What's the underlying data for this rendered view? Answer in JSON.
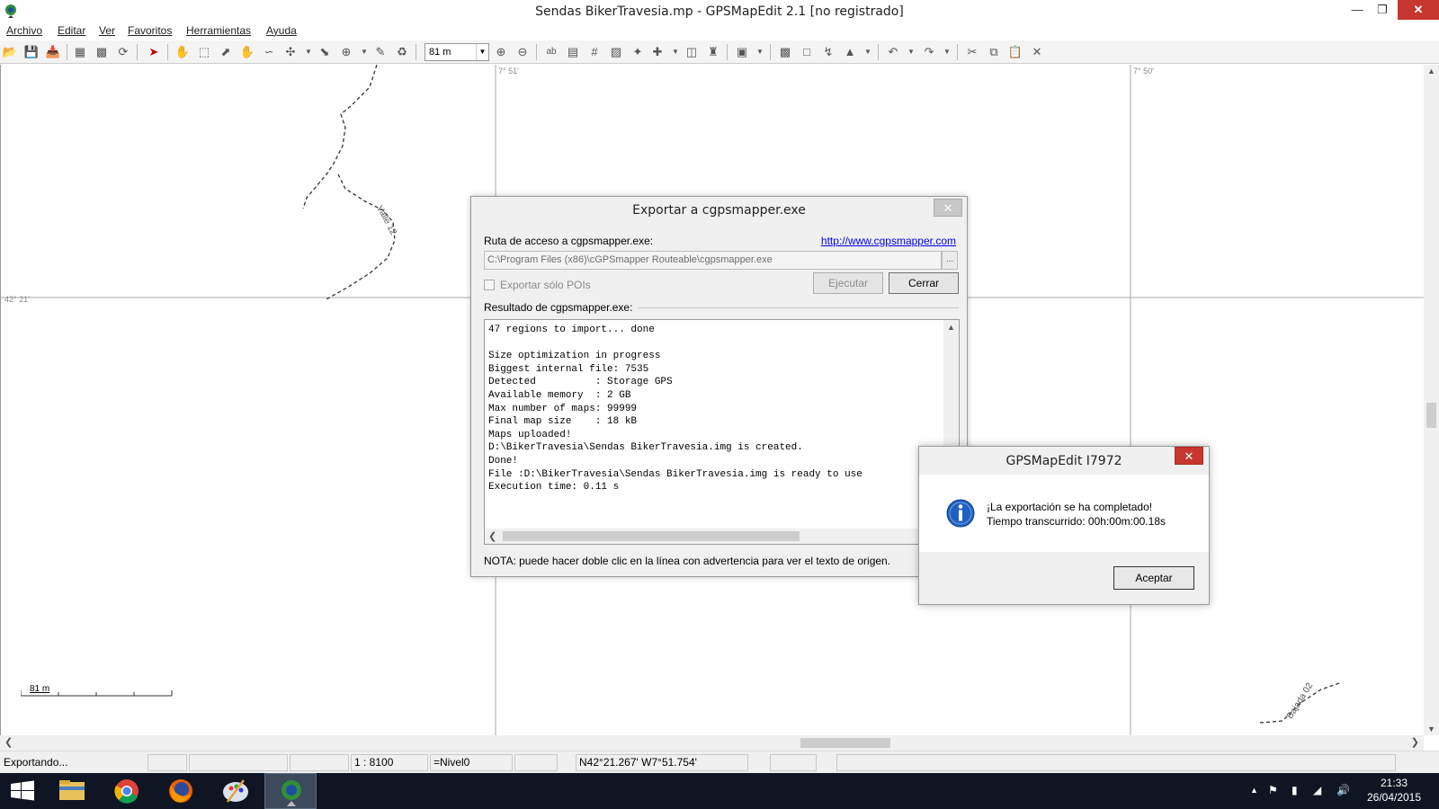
{
  "window": {
    "title": "Sendas BikerTravesia.mp - GPSMapEdit 2.1 [no registrado]"
  },
  "menu": {
    "items": [
      "Archivo",
      "Editar",
      "Ver",
      "Favoritos",
      "Herramientas",
      "Ayuda"
    ]
  },
  "toolbar": {
    "zoom_value": "81 m"
  },
  "map": {
    "lon_labels": [
      "7° 51'",
      "7° 50'"
    ],
    "lat_label": "42° 21'",
    "track_labels": [
      "Valle 12",
      "Bajada 02"
    ],
    "scale_label": "81 m"
  },
  "export_dialog": {
    "title": "Exportar a cgpsmapper.exe",
    "path_label": "Ruta de acceso a cgpsmapper.exe:",
    "link": "http://www.cgpsmapper.com",
    "path_value": "C:\\Program Files (x86)\\cGPSmapper Routeable\\cgpsmapper.exe",
    "browse_label": "...",
    "checkbox_label": "Exportar sólo POIs",
    "run_button": "Ejecutar",
    "close_button": "Cerrar",
    "result_label": "Resultado de cgpsmapper.exe:",
    "output_lines": [
      "47 regions to import... done",
      "",
      "Size optimization in progress",
      "Biggest internal file: 7535",
      "Detected          : Storage GPS",
      "Available memory  : 2 GB",
      "Max number of maps: 99999",
      "Final map size    : 18 kB",
      "Maps uploaded!",
      "D:\\BikerTravesia\\Sendas BikerTravesia.img is created.",
      "Done!",
      "File :D:\\BikerTravesia\\Sendas BikerTravesia.img is ready to use",
      "Execution time: 0.11 s"
    ],
    "note": "NOTA: puede hacer doble clic en la línea con advertencia para ver el texto de origen."
  },
  "message_box": {
    "title": "GPSMapEdit I7972",
    "line1": "¡La exportación se ha completado!",
    "line2": "Tiempo transcurrido: 00h:00m:00.18s",
    "ok_button": "Aceptar"
  },
  "statusbar": {
    "status": "Exportando...",
    "scale": "1 : 8100",
    "level": "=Nivel0",
    "coords": "N42°21.267' W7°51.754'"
  },
  "taskbar": {
    "time": "21:33",
    "date": "26/04/2015"
  },
  "colors": {
    "close_red": "#c7372f",
    "taskbar": "#0f1522",
    "link_blue": "#0000ee",
    "info_blue": "#2060c0"
  }
}
